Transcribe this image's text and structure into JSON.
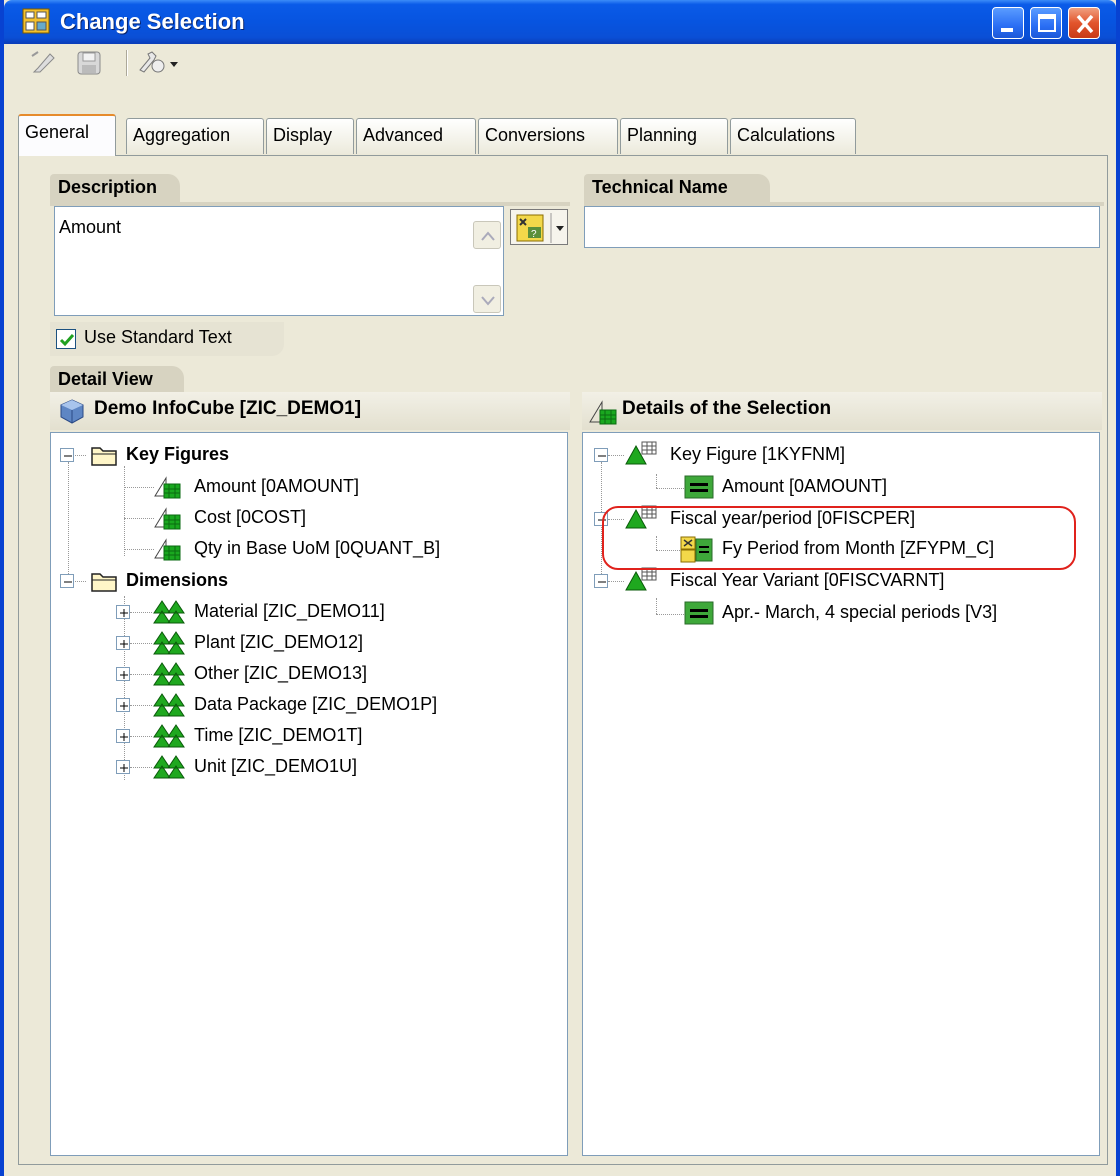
{
  "window": {
    "title": "Change Selection"
  },
  "tabs": [
    "General",
    "Aggregation",
    "Display",
    "Advanced",
    "Conversions",
    "Planning",
    "Calculations"
  ],
  "general": {
    "description_header": "Description",
    "description_value": "Amount",
    "technical_name_header": "Technical Name",
    "technical_name_value": "",
    "use_standard_text_label": "Use Standard Text",
    "use_standard_text_checked": true,
    "detail_view_header": "Detail View"
  },
  "left_panel": {
    "title": "Demo InfoCube [ZIC_DEMO1]",
    "key_figures_label": "Key Figures",
    "key_figures": [
      "Amount [0AMOUNT]",
      "Cost [0COST]",
      "Qty in Base UoM [0QUANT_B]"
    ],
    "dimensions_label": "Dimensions",
    "dimensions": [
      "Material [ZIC_DEMO11]",
      "Plant [ZIC_DEMO12]",
      "Other [ZIC_DEMO13]",
      "Data Package [ZIC_DEMO1P]",
      "Time [ZIC_DEMO1T]",
      "Unit [ZIC_DEMO1U]"
    ]
  },
  "right_panel": {
    "title": "Details of the Selection",
    "items": [
      {
        "label": "Key Figure [1KYFNM]",
        "child": "Amount [0AMOUNT]"
      },
      {
        "label": "Fiscal year/period [0FISCPER]",
        "child": "Fy Period from Month [ZFYPM_C]"
      },
      {
        "label": "Fiscal Year Variant [0FISCVARNT]",
        "child": "Apr.- March, 4 special periods [V3]"
      }
    ]
  },
  "colors": {
    "title_bar": "#0754e0",
    "highlight": "#e0221c",
    "panel_border": "#7f9db9",
    "face": "#ece9d8"
  },
  "icons": [
    "window-icon",
    "minimize-icon",
    "maximize-icon",
    "close-icon",
    "edit-icon",
    "save-icon",
    "tools-icon",
    "folder-icon",
    "key-figure-icon",
    "characteristic-icon",
    "equals-icon",
    "variable-icon",
    "infocube-icon"
  ]
}
